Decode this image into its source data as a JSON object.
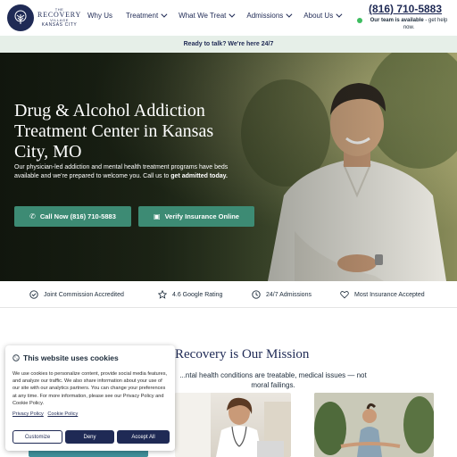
{
  "brand": {
    "logo_line1": "THE",
    "logo_line2": "RECOVERY",
    "logo_line3": "VILLAGE",
    "logo_line4": "KANSAS CITY"
  },
  "nav": {
    "items": [
      {
        "label": "Why Us",
        "has_dropdown": false
      },
      {
        "label": "Treatment",
        "has_dropdown": true
      },
      {
        "label": "What We Treat",
        "has_dropdown": true
      },
      {
        "label": "Admissions",
        "has_dropdown": true
      },
      {
        "label": "About Us",
        "has_dropdown": true
      }
    ]
  },
  "contact": {
    "phone": "(816) 710-5883",
    "status_bold": "Our team is available",
    "status_rest": " - get help now."
  },
  "banner": {
    "text": "Ready to talk? We're here 24/7"
  },
  "hero": {
    "title": "Drug & Alcohol Addiction Treatment Center in Kansas City, MO",
    "body": "Our physician-led addiction and mental health treatment programs have beds available and we're prepared to welcome you. Call us to ",
    "body_bold": "get admitted today.",
    "call_button": "Call Now (816) 710-5883",
    "verify_button": "Verify Insurance Online"
  },
  "trust": {
    "items": [
      {
        "label": "Joint Commission Accredited",
        "icon": "badge-check-icon"
      },
      {
        "label": "4.6 Google Rating",
        "icon": "star-icon"
      },
      {
        "label": "24/7 Admissions",
        "icon": "clock-icon"
      },
      {
        "label": "Most Insurance Accepted",
        "icon": "heart-icon"
      }
    ]
  },
  "mission": {
    "title": "Recovery is Our Mission",
    "subtitle": "...ntal health conditions are treatable, medical issues — not moral failings."
  },
  "cookie": {
    "title": "This website uses cookies",
    "text": "We use cookies to personalize content, provide social media features, and analyze our traffic. We also share information about your use of our site with our analytics partners. You can change your preferences at any time. For more information, please see our Privacy Policy and Cookie Policy.",
    "link_privacy": "Privacy Policy",
    "link_cookie": "Cookie Policy",
    "customize": "Customize",
    "deny": "Deny",
    "accept": "Accept All"
  },
  "colors": {
    "navy": "#1f2a55",
    "teal_button": "#3d8b74",
    "banner_bg": "#e6efe8",
    "available_dot": "#3ebd60"
  }
}
